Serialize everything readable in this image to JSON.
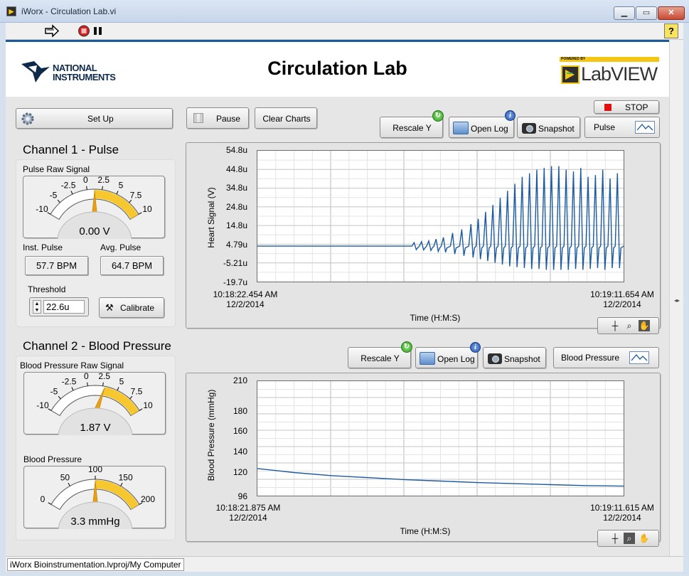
{
  "window": {
    "title": "iWorx - Circulation Lab.vi"
  },
  "header": {
    "title": "Circulation Lab",
    "ni_logo_text": "NATIONAL\nINSTRUMENTS",
    "labview_text": "LabVIEW",
    "labview_powered": "POWERED BY"
  },
  "controls": {
    "setup_label": "Set Up",
    "pause_label": "Pause",
    "clear_label": "Clear Charts",
    "stop_label": "STOP"
  },
  "channel1": {
    "title": "Channel 1 - Pulse",
    "gauge_label": "Pulse Raw Signal",
    "gauge_ticks": [
      "-10",
      "-5",
      "-2.5",
      "0",
      "2.5",
      "5",
      "7.5",
      "10"
    ],
    "gauge_value": "0.00 V",
    "gauge_level": 0.5,
    "inst_label": "Inst. Pulse",
    "inst_value": "57.7 BPM",
    "avg_label": "Avg. Pulse",
    "avg_value": "64.7 BPM",
    "threshold_label": "Threshold",
    "threshold_value": "22.6u",
    "calibrate_label": "Calibrate"
  },
  "channel2": {
    "title": "Channel 2 - Blood Pressure",
    "gauge_label": "Blood Pressure Raw Signal",
    "gauge_ticks": [
      "-10",
      "-5",
      "-2.5",
      "0",
      "2.5",
      "5",
      "7.5",
      "10"
    ],
    "gauge_value": "1.87 V",
    "gauge_level": 0.59,
    "bp_label": "Blood Pressure",
    "bp_ticks": [
      "0",
      "50",
      "100",
      "150",
      "200"
    ],
    "bp_value": "3.3 mmHg",
    "bp_level": 0.5
  },
  "chart1": {
    "rescale_label": "Rescale Y",
    "openlog_label": "Open Log",
    "snapshot_label": "Snapshot",
    "legend_label": "Pulse",
    "x_title": "Time (H:M:S)",
    "x_start": "10:18:22.454 AM",
    "x_start_date": "12/2/2014",
    "x_end": "10:19:11.654 AM",
    "x_end_date": "12/2/2014"
  },
  "chart2": {
    "rescale_label": "Rescale Y",
    "openlog_label": "Open Log",
    "snapshot_label": "Snapshot",
    "legend_label": "Blood Pressure",
    "x_title": "Time (H:M:S)",
    "x_start": "10:18:21.875 AM",
    "x_start_date": "12/2/2014",
    "x_end": "10:19:11.615 AM",
    "x_end_date": "12/2/2014"
  },
  "chart_data": [
    {
      "type": "line",
      "ylabel": "Heart Signal  (V)",
      "xlabel": "Time (H:M:S)",
      "y_ticks": [
        "54.8u",
        "44.8u",
        "34.8u",
        "24.8u",
        "14.8u",
        "4.79u",
        "-5.21u",
        "-19.7u"
      ],
      "ylim": [
        -19.7,
        54.8
      ],
      "x_range": [
        "10:18:22.454",
        "10:19:11.654"
      ],
      "grid": true,
      "series": [
        {
          "name": "Pulse",
          "baseline": 0.5,
          "beats_x": [
            0.43,
            0.45,
            0.47,
            0.49,
            0.51,
            0.535,
            0.56,
            0.585,
            0.605,
            0.625,
            0.645,
            0.665,
            0.685,
            0.705,
            0.725,
            0.745,
            0.765,
            0.785,
            0.805,
            0.825,
            0.845,
            0.865,
            0.885,
            0.905,
            0.925,
            0.945,
            0.965,
            0.985
          ],
          "beats_peak": [
            2.5,
            3.0,
            3.5,
            4.5,
            5.5,
            8,
            10,
            13,
            16,
            20,
            24,
            28,
            32,
            36,
            40,
            42,
            44,
            45,
            46,
            46,
            44,
            43,
            45,
            40,
            41,
            44,
            39,
            42
          ],
          "beats_trough": [
            -1.5,
            -1.7,
            -2,
            -2.5,
            -3,
            -4,
            -5,
            -6,
            -7,
            -8,
            -9,
            -10,
            -11,
            -11.5,
            -12,
            -12.5,
            -12.5,
            -13,
            -13,
            -13,
            -13,
            -12.5,
            -13,
            -12.5,
            -12,
            -13,
            -12,
            -12
          ]
        }
      ]
    },
    {
      "type": "line",
      "ylabel": "Blood Pressure (mmHg)",
      "xlabel": "Time (H:M:S)",
      "y_ticks": [
        "210",
        "180",
        "160",
        "140",
        "120",
        "96"
      ],
      "ylim": [
        96,
        210
      ],
      "x_range": [
        "10:18:21.875",
        "10:19:11.615"
      ],
      "grid": true,
      "series": [
        {
          "name": "Blood Pressure",
          "x": [
            0,
            0.05,
            0.1,
            0.2,
            0.3,
            0.4,
            0.5,
            0.6,
            0.7,
            0.8,
            0.9,
            1.0
          ],
          "y": [
            123,
            121,
            119,
            116,
            114,
            112,
            110.5,
            109,
            108,
            107,
            106,
            105.5
          ]
        }
      ]
    }
  ],
  "statusbar": {
    "path": "iWorx Bioinstrumentation.lvproj/My Computer"
  },
  "colors": {
    "accent": "#1d5b96",
    "trace": "#1c5aa0",
    "gauge_fill": "#f5c118"
  }
}
